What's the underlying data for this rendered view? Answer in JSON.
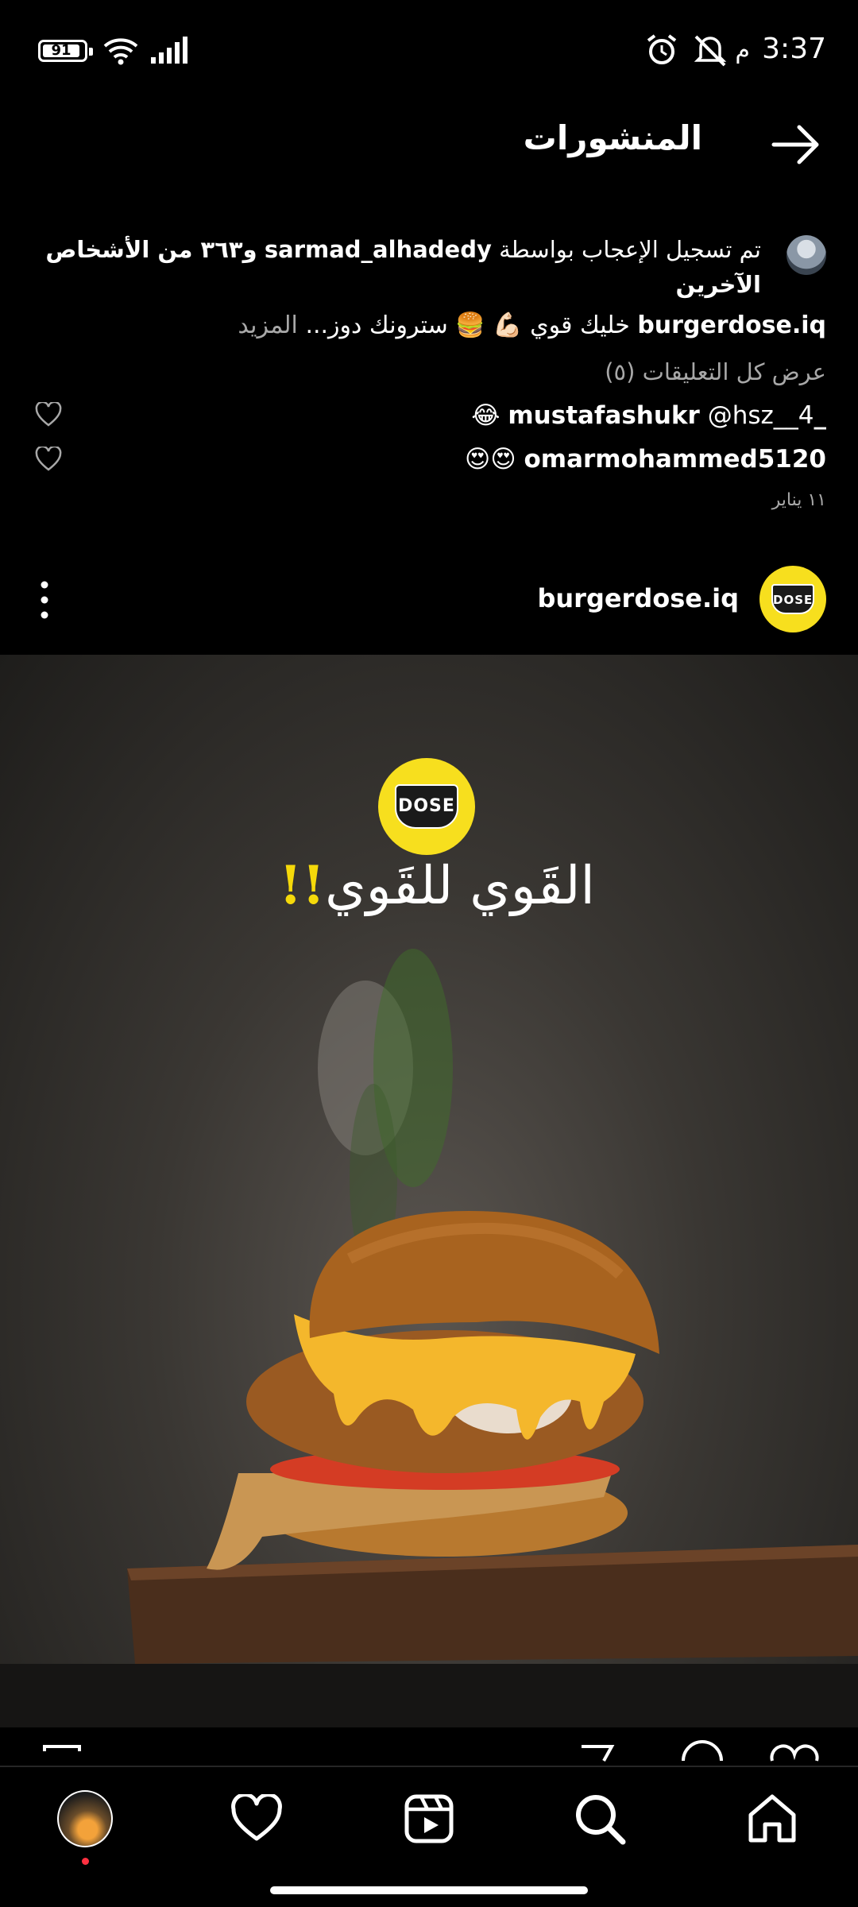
{
  "status_bar": {
    "battery": "91",
    "time": "3:37",
    "ampm": "م"
  },
  "header": {
    "title": "المنشورات"
  },
  "likes": {
    "prefix": "تم تسجيل الإعجاب بواسطة",
    "user": "sarmad_alhadedy",
    "suffix": "و٣٦٣ من الأشخاص الآخرين"
  },
  "caption": {
    "user": "burgerdose.iq",
    "text": "خليك قوي 💪🏻 🍔 سترونك دوز...",
    "more": "المزيد"
  },
  "comments": {
    "view_all": "عرض كل التعليقات (٥)",
    "items": [
      {
        "user": "_mustafashukr",
        "text": "@hsz__4 😂"
      },
      {
        "user": "omarmohammed5120",
        "text": "😍😍"
      }
    ]
  },
  "post_date": "١١ يناير",
  "post": {
    "username": "burgerdose.iq",
    "logo_text": "DOSE",
    "slogan": "القَوي للقَوي",
    "slogan_bang": "!!"
  },
  "colors": {
    "brand_yellow": "#f7df1e",
    "muted_text": "#a8a8a8",
    "notification_dot": "#ff3040"
  },
  "icons": {
    "back": "arrow-right-icon",
    "more": "more-vertical-icon",
    "nav": [
      "profile-avatar",
      "heart-icon",
      "reels-icon",
      "search-icon",
      "home-icon"
    ]
  }
}
